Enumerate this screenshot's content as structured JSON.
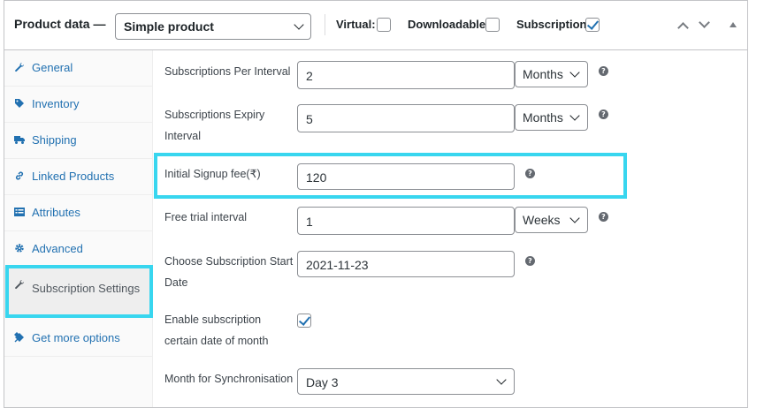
{
  "header": {
    "title": "Product data —",
    "product_type": "Simple product",
    "virtual_label": "Virtual:",
    "downloadable_label": "Downloadable:",
    "subscription_label": "Subscription:",
    "virtual_checked": false,
    "downloadable_checked": false,
    "subscription_checked": true
  },
  "sidebar": {
    "items": [
      {
        "label": "General",
        "icon": "wrench-icon"
      },
      {
        "label": "Inventory",
        "icon": "tag-icon"
      },
      {
        "label": "Shipping",
        "icon": "truck-icon"
      },
      {
        "label": "Linked Products",
        "icon": "link-icon"
      },
      {
        "label": "Attributes",
        "icon": "list-icon"
      },
      {
        "label": "Advanced",
        "icon": "gear-icon"
      },
      {
        "label": "Subscription Settings",
        "icon": "wrench-icon",
        "active": true
      },
      {
        "label": "Get more options",
        "icon": "plugin-icon"
      }
    ]
  },
  "fields": {
    "per_interval": {
      "label": "Subscriptions Per Interval",
      "value": "2",
      "unit": "Months"
    },
    "expiry_interval": {
      "label": "Subscriptions Expiry Interval",
      "value": "5",
      "unit": "Months"
    },
    "signup_fee": {
      "label": "Initial Signup fee(₹)",
      "value": "120"
    },
    "free_trial": {
      "label": "Free trial interval",
      "value": "1",
      "unit": "Weeks"
    },
    "start_date": {
      "label": "Choose Subscription Start Date",
      "value": "2021-11-23"
    },
    "certain_date": {
      "label": "Enable subscription certain date of month",
      "checked": true
    },
    "sync_month": {
      "label": "Month for Synchronisation",
      "value": "Day 3"
    }
  },
  "help_glyph": "?",
  "colors": {
    "link": "#2271b1",
    "highlight": "#38d6ef",
    "border": "#8c8f94"
  }
}
